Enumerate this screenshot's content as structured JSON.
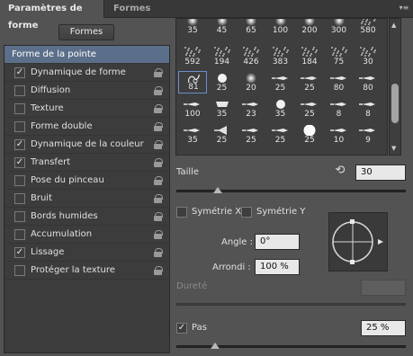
{
  "tabs": [
    {
      "label": "Paramètres de forme"
    },
    {
      "label": "Formes"
    }
  ],
  "menu_icon": "flyout-menu-icon",
  "presets_button": "Formes",
  "options": [
    {
      "label": "Forme de la pointe",
      "checked": null,
      "lock": false,
      "selected": true
    },
    {
      "label": "Dynamique de forme",
      "checked": true,
      "lock": true
    },
    {
      "label": "Diffusion",
      "checked": false,
      "lock": true
    },
    {
      "label": "Texture",
      "checked": false,
      "lock": true
    },
    {
      "label": "Forme double",
      "checked": false,
      "lock": true
    },
    {
      "label": "Dynamique de la couleur",
      "checked": true,
      "lock": true
    },
    {
      "label": "Transfert",
      "checked": true,
      "lock": true
    },
    {
      "label": "Pose du pinceau",
      "checked": false,
      "lock": true
    },
    {
      "label": "Bruit",
      "checked": false,
      "lock": true
    },
    {
      "label": "Bords humides",
      "checked": false,
      "lock": true
    },
    {
      "label": "Accumulation",
      "checked": false,
      "lock": true
    },
    {
      "label": "Lissage",
      "checked": true,
      "lock": true
    },
    {
      "label": "Protéger la texture",
      "checked": false,
      "lock": true
    }
  ],
  "tips": [
    [
      "35",
      "45",
      "65",
      "100",
      "200",
      "300",
      "580"
    ],
    [
      "592",
      "194",
      "426",
      "383",
      "184",
      "75",
      "30"
    ],
    [
      "81",
      "25",
      "20",
      "25",
      "25",
      "80",
      "80"
    ],
    [
      "100",
      "35",
      "23",
      "35",
      "25",
      "8",
      "8"
    ],
    [
      "35",
      "25",
      "25",
      "25",
      "25",
      "10",
      "9"
    ]
  ],
  "tip_kinds": [
    [
      "soft",
      "soft",
      "soft",
      "soft",
      "soft",
      "soft",
      "scatter"
    ],
    [
      "scatter",
      "scatter",
      "scatter",
      "scatter",
      "scatter",
      "scatter",
      "scatter"
    ],
    [
      "special",
      "hard",
      "soft",
      "brush",
      "brush",
      "brush",
      "brush"
    ],
    [
      "brush",
      "flat",
      "brush",
      "hard",
      "brush",
      "brush",
      "brush"
    ],
    [
      "brush",
      "fan",
      "brush",
      "brush",
      "hardbig",
      "brush",
      "brush"
    ]
  ],
  "selected_tip": {
    "row": 2,
    "col": 0
  },
  "size": {
    "label": "Taille",
    "value": "30",
    "slider": 0.18
  },
  "flip_x": {
    "label": "Symétrie X",
    "checked": false
  },
  "flip_y": {
    "label": "Symétrie Y",
    "checked": false
  },
  "angle": {
    "label": "Angle :",
    "value": "0°"
  },
  "roundness": {
    "label": "Arrondi :",
    "value": "100 %"
  },
  "hardness": {
    "label": "Dureté",
    "value": "",
    "enabled": false
  },
  "spacing": {
    "label": "Pas",
    "checked": true,
    "value": "25 %",
    "slider": 0.17
  },
  "accent_color": "#5c6f8a"
}
